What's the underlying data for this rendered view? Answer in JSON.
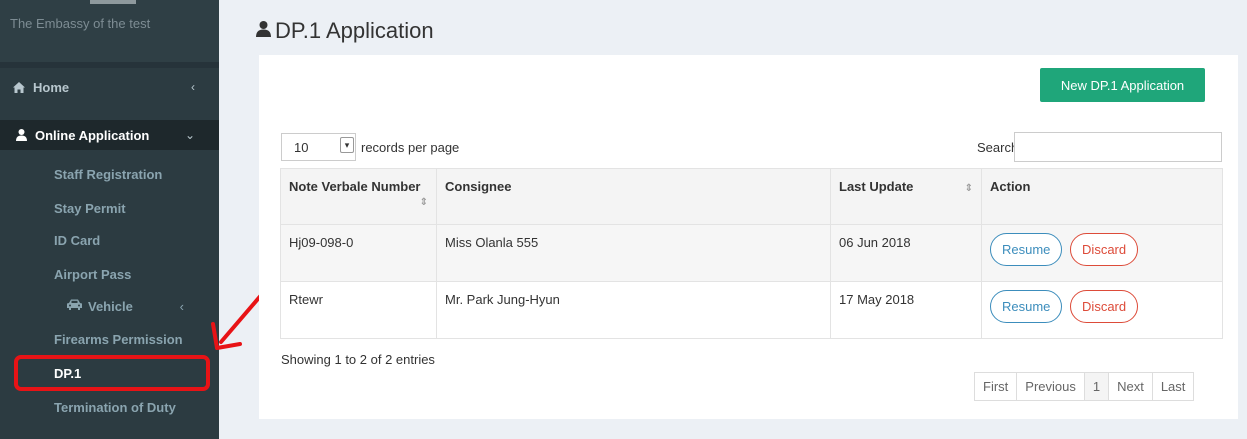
{
  "sidebar": {
    "brand": "The Embassy of the test",
    "home": "Home",
    "online_application": "Online Application",
    "items": [
      "Staff Registration",
      "Stay Permit",
      "ID Card",
      "Airport Pass",
      "Vehicle",
      "Firearms Permission",
      "DP.1",
      "Termination of Duty"
    ]
  },
  "header": {
    "title": "DP.1 Application"
  },
  "toolbar": {
    "new_label": "New DP.1 Application"
  },
  "table_controls": {
    "page_length": "10",
    "length_suffix": "records per page",
    "search_label": "Search:",
    "search_value": ""
  },
  "table": {
    "columns": [
      "Note Verbale Number",
      "Consignee",
      "Last Update",
      "Action"
    ],
    "rows": [
      {
        "number": "Hj09-098-0",
        "consignee": "Miss Olanla 555",
        "updated": "06 Jun 2018",
        "resume": "Resume",
        "discard": "Discard"
      },
      {
        "number": "Rtewr",
        "consignee": "Mr. Park Jung-Hyun",
        "updated": "17 May 2018",
        "resume": "Resume",
        "discard": "Discard"
      }
    ]
  },
  "footer": {
    "info": "Showing 1 to 2 of 2 entries",
    "pager": [
      "First",
      "Previous",
      "1",
      "Next",
      "Last"
    ]
  },
  "colors": {
    "primary": "#3c8dbc",
    "danger": "#dd4b39",
    "success": "#1fa67a",
    "highlight": "#e81316"
  }
}
